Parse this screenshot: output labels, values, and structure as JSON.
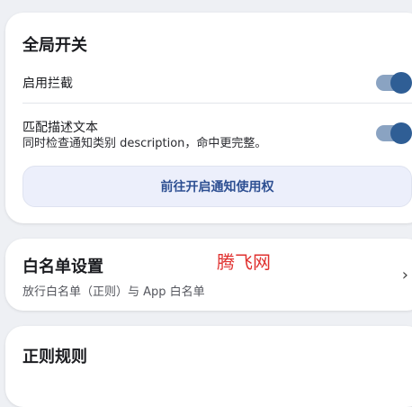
{
  "global_switch": {
    "title": "全局开关",
    "intercept_label": "启用拦截",
    "intercept_on": true,
    "match_desc_label": "匹配描述文本",
    "match_desc_sub": "同时检查通知类别 description，命中更完整。",
    "match_desc_on": true,
    "grant_button_label": "前往开启通知使用权"
  },
  "whitelist": {
    "title": "白名单设置",
    "subtitle": "放行白名单（正则）与 App 白名单",
    "chevron": "›"
  },
  "regex_rules": {
    "title": "正则规则"
  },
  "watermark": "腾飞网",
  "colors": {
    "accent": "#2f5e95",
    "switch_track": "#8aa3c2",
    "button_bg": "#eceffb",
    "button_text": "#2d4f92",
    "watermark": "#e0312f"
  }
}
